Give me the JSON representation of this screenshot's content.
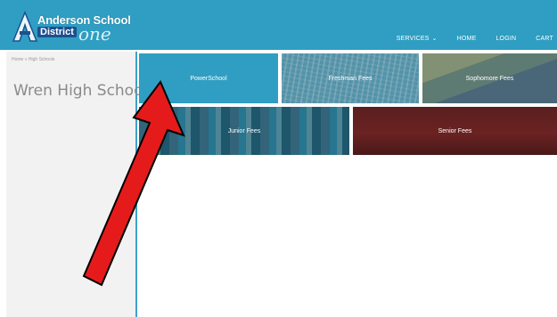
{
  "header": {
    "logo": {
      "line1": "Anderson School",
      "line2": "District",
      "one": "one"
    },
    "nav": [
      {
        "label": "SERVICES",
        "icon": "chevron-down-icon"
      },
      {
        "label": "HOME"
      },
      {
        "label": "LOGIN"
      },
      {
        "label": "CART"
      }
    ]
  },
  "sidebar": {
    "breadcrumb": "Home » High Schools",
    "title": "Wren High School"
  },
  "tiles": [
    {
      "label": "PowerSchool"
    },
    {
      "label": "Freshman Fees"
    },
    {
      "label": "Sophomore Fees"
    },
    {
      "label": "Junior Fees"
    },
    {
      "label": "Senior Fees"
    }
  ],
  "colors": {
    "header": "#2f9ec2",
    "arrow": "#e51b1b",
    "senior_tile": "#6b2222"
  }
}
